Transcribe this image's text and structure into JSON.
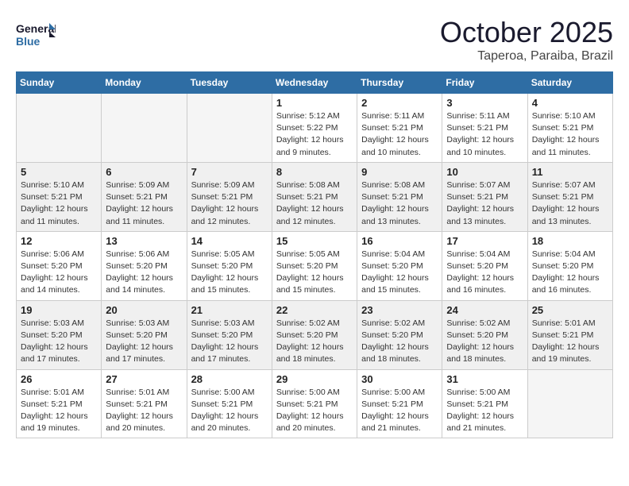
{
  "header": {
    "logo_line1": "General",
    "logo_line2": "Blue",
    "month": "October 2025",
    "location": "Taperoa, Paraiba, Brazil"
  },
  "weekdays": [
    "Sunday",
    "Monday",
    "Tuesday",
    "Wednesday",
    "Thursday",
    "Friday",
    "Saturday"
  ],
  "weeks": [
    [
      {
        "day": "",
        "info": ""
      },
      {
        "day": "",
        "info": ""
      },
      {
        "day": "",
        "info": ""
      },
      {
        "day": "1",
        "info": "Sunrise: 5:12 AM\nSunset: 5:22 PM\nDaylight: 12 hours\nand 9 minutes."
      },
      {
        "day": "2",
        "info": "Sunrise: 5:11 AM\nSunset: 5:21 PM\nDaylight: 12 hours\nand 10 minutes."
      },
      {
        "day": "3",
        "info": "Sunrise: 5:11 AM\nSunset: 5:21 PM\nDaylight: 12 hours\nand 10 minutes."
      },
      {
        "day": "4",
        "info": "Sunrise: 5:10 AM\nSunset: 5:21 PM\nDaylight: 12 hours\nand 11 minutes."
      }
    ],
    [
      {
        "day": "5",
        "info": "Sunrise: 5:10 AM\nSunset: 5:21 PM\nDaylight: 12 hours\nand 11 minutes."
      },
      {
        "day": "6",
        "info": "Sunrise: 5:09 AM\nSunset: 5:21 PM\nDaylight: 12 hours\nand 11 minutes."
      },
      {
        "day": "7",
        "info": "Sunrise: 5:09 AM\nSunset: 5:21 PM\nDaylight: 12 hours\nand 12 minutes."
      },
      {
        "day": "8",
        "info": "Sunrise: 5:08 AM\nSunset: 5:21 PM\nDaylight: 12 hours\nand 12 minutes."
      },
      {
        "day": "9",
        "info": "Sunrise: 5:08 AM\nSunset: 5:21 PM\nDaylight: 12 hours\nand 13 minutes."
      },
      {
        "day": "10",
        "info": "Sunrise: 5:07 AM\nSunset: 5:21 PM\nDaylight: 12 hours\nand 13 minutes."
      },
      {
        "day": "11",
        "info": "Sunrise: 5:07 AM\nSunset: 5:21 PM\nDaylight: 12 hours\nand 13 minutes."
      }
    ],
    [
      {
        "day": "12",
        "info": "Sunrise: 5:06 AM\nSunset: 5:20 PM\nDaylight: 12 hours\nand 14 minutes."
      },
      {
        "day": "13",
        "info": "Sunrise: 5:06 AM\nSunset: 5:20 PM\nDaylight: 12 hours\nand 14 minutes."
      },
      {
        "day": "14",
        "info": "Sunrise: 5:05 AM\nSunset: 5:20 PM\nDaylight: 12 hours\nand 15 minutes."
      },
      {
        "day": "15",
        "info": "Sunrise: 5:05 AM\nSunset: 5:20 PM\nDaylight: 12 hours\nand 15 minutes."
      },
      {
        "day": "16",
        "info": "Sunrise: 5:04 AM\nSunset: 5:20 PM\nDaylight: 12 hours\nand 15 minutes."
      },
      {
        "day": "17",
        "info": "Sunrise: 5:04 AM\nSunset: 5:20 PM\nDaylight: 12 hours\nand 16 minutes."
      },
      {
        "day": "18",
        "info": "Sunrise: 5:04 AM\nSunset: 5:20 PM\nDaylight: 12 hours\nand 16 minutes."
      }
    ],
    [
      {
        "day": "19",
        "info": "Sunrise: 5:03 AM\nSunset: 5:20 PM\nDaylight: 12 hours\nand 17 minutes."
      },
      {
        "day": "20",
        "info": "Sunrise: 5:03 AM\nSunset: 5:20 PM\nDaylight: 12 hours\nand 17 minutes."
      },
      {
        "day": "21",
        "info": "Sunrise: 5:03 AM\nSunset: 5:20 PM\nDaylight: 12 hours\nand 17 minutes."
      },
      {
        "day": "22",
        "info": "Sunrise: 5:02 AM\nSunset: 5:20 PM\nDaylight: 12 hours\nand 18 minutes."
      },
      {
        "day": "23",
        "info": "Sunrise: 5:02 AM\nSunset: 5:20 PM\nDaylight: 12 hours\nand 18 minutes."
      },
      {
        "day": "24",
        "info": "Sunrise: 5:02 AM\nSunset: 5:20 PM\nDaylight: 12 hours\nand 18 minutes."
      },
      {
        "day": "25",
        "info": "Sunrise: 5:01 AM\nSunset: 5:21 PM\nDaylight: 12 hours\nand 19 minutes."
      }
    ],
    [
      {
        "day": "26",
        "info": "Sunrise: 5:01 AM\nSunset: 5:21 PM\nDaylight: 12 hours\nand 19 minutes."
      },
      {
        "day": "27",
        "info": "Sunrise: 5:01 AM\nSunset: 5:21 PM\nDaylight: 12 hours\nand 20 minutes."
      },
      {
        "day": "28",
        "info": "Sunrise: 5:00 AM\nSunset: 5:21 PM\nDaylight: 12 hours\nand 20 minutes."
      },
      {
        "day": "29",
        "info": "Sunrise: 5:00 AM\nSunset: 5:21 PM\nDaylight: 12 hours\nand 20 minutes."
      },
      {
        "day": "30",
        "info": "Sunrise: 5:00 AM\nSunset: 5:21 PM\nDaylight: 12 hours\nand 21 minutes."
      },
      {
        "day": "31",
        "info": "Sunrise: 5:00 AM\nSunset: 5:21 PM\nDaylight: 12 hours\nand 21 minutes."
      },
      {
        "day": "",
        "info": ""
      }
    ]
  ]
}
